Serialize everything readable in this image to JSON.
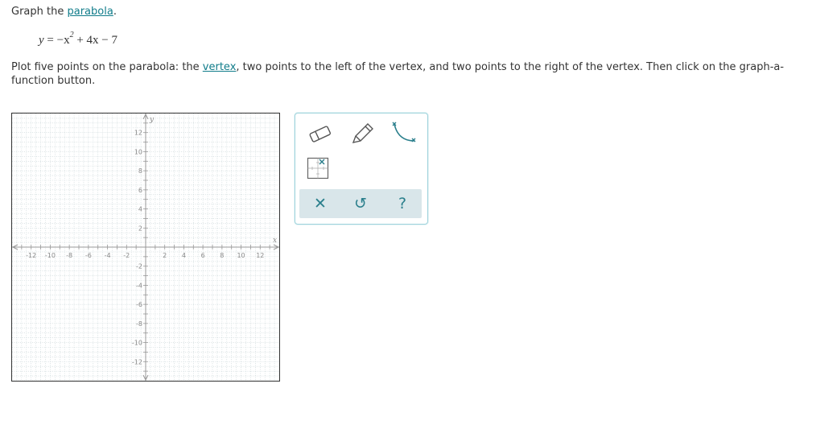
{
  "question": {
    "prefix": "Graph the ",
    "term1": "parabola",
    "suffix1": "."
  },
  "equation": {
    "lhs": "y",
    "rhs_pre": " = −x",
    "exp": "2",
    "rhs_post": " + 4x − 7"
  },
  "instructions": {
    "part1": "Plot five points on the parabola: the ",
    "term": "vertex",
    "part2": ", two points to the left of the vertex, and two points to the right of the vertex. Then click on the graph-a-function button."
  },
  "graph": {
    "x_axis_label": "x",
    "y_axis_label": "y",
    "xlim": [
      -14,
      14
    ],
    "ylim": [
      -14,
      14
    ],
    "x_tick_labels": [
      "-12",
      "-10",
      "-8",
      "-6",
      "-4",
      "-2",
      "2",
      "4",
      "6",
      "8",
      "10",
      "12"
    ],
    "x_tick_values": [
      -12,
      -10,
      -8,
      -6,
      -4,
      -2,
      2,
      4,
      6,
      8,
      10,
      12
    ],
    "y_tick_labels": [
      "12",
      "10",
      "8",
      "6",
      "4",
      "2",
      "-2",
      "-4",
      "-6",
      "-8",
      "-10",
      "-12"
    ],
    "y_tick_values": [
      12,
      10,
      8,
      6,
      4,
      2,
      -2,
      -4,
      -6,
      -8,
      -10,
      -12
    ],
    "grid_color": "#c7d3d6",
    "axis_color": "#999999"
  },
  "toolbox": {
    "tools": [
      "eraser-icon",
      "pencil-icon",
      "curve-icon",
      "graph-a-function-icon"
    ],
    "actions": {
      "clear": "✕",
      "undo": "↺",
      "help": "?"
    },
    "accent_color": "#2a7f8c",
    "action_bar_color": "#d9e6ea"
  }
}
